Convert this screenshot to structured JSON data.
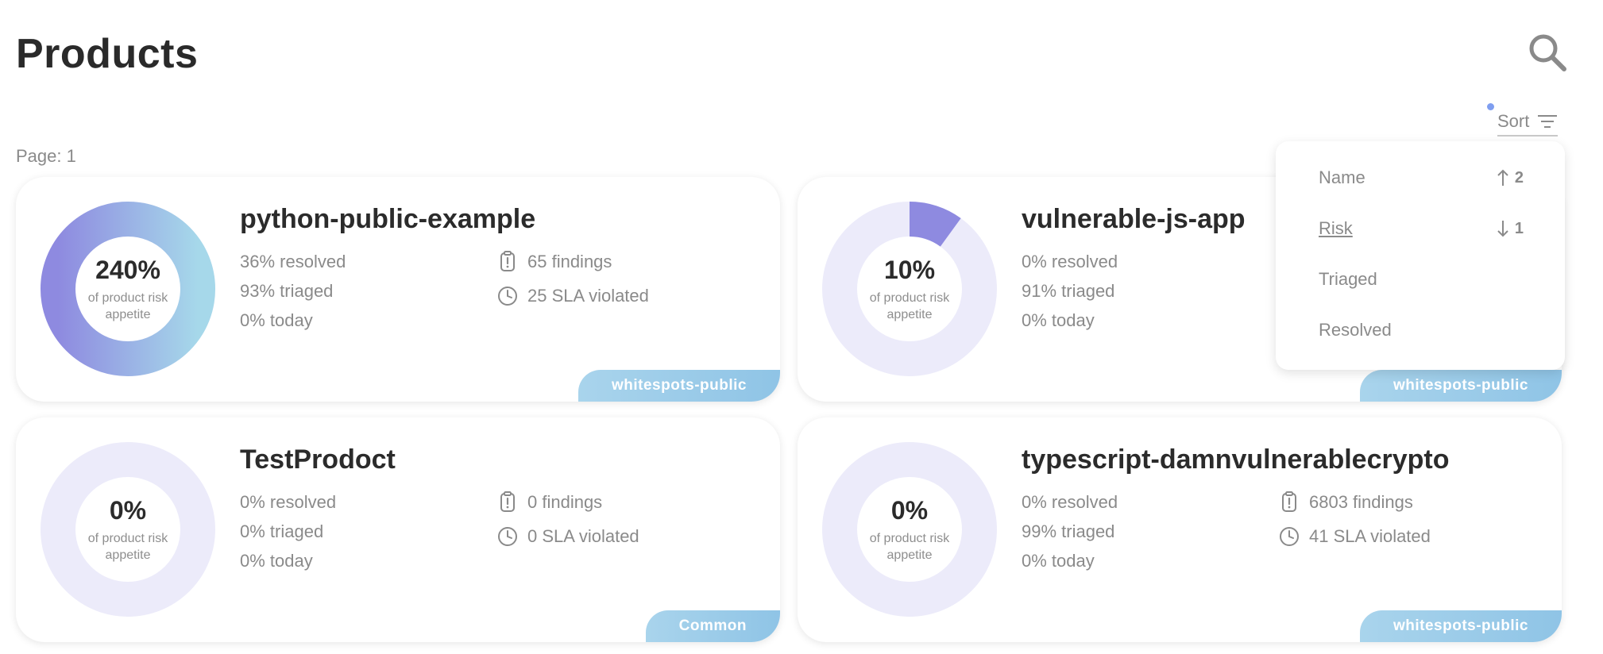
{
  "page": {
    "title": "Products",
    "page_label": "Page: 1",
    "search_icon": "search-icon"
  },
  "sort": {
    "label": "Sort",
    "icon": "filter-lines-icon",
    "options": [
      {
        "label": "Name",
        "direction": "up",
        "order": "2",
        "active": false
      },
      {
        "label": "Risk",
        "direction": "down",
        "order": "1",
        "active": true
      },
      {
        "label": "Triaged",
        "direction": "",
        "order": "",
        "active": false
      },
      {
        "label": "Resolved",
        "direction": "",
        "order": "",
        "active": false
      }
    ]
  },
  "products": [
    {
      "name": "python-public-example",
      "risk_percent": "240%",
      "risk_fraction": 1.0,
      "risk_caption": "of product risk appetite",
      "resolved": "36% resolved",
      "triaged": "93% triaged",
      "today": "0% today",
      "findings": "65 findings",
      "sla": "25 SLA violated",
      "tag": "whitespots-public"
    },
    {
      "name": "vulnerable-js-app",
      "risk_percent": "10%",
      "risk_fraction": 0.1,
      "risk_caption": "of product risk appetite",
      "resolved": "0% resolved",
      "triaged": "91% triaged",
      "today": "0% today",
      "findings": "",
      "sla": "",
      "tag": "whitespots-public"
    },
    {
      "name": "TestProdoct",
      "risk_percent": "0%",
      "risk_fraction": 0,
      "risk_caption": "of product risk appetite",
      "resolved": "0% resolved",
      "triaged": "0% triaged",
      "today": "0% today",
      "findings": "0 findings",
      "sla": "0 SLA violated",
      "tag": "Common"
    },
    {
      "name": "typescript-damnvulnerablecrypto",
      "risk_percent": "0%",
      "risk_fraction": 0,
      "risk_caption": "of product risk appetite",
      "resolved": "0% resolved",
      "triaged": "99% triaged",
      "today": "0% today",
      "findings": "6803 findings",
      "sla": "41 SLA violated",
      "tag": "whitespots-public"
    }
  ],
  "colors": {
    "ring_track": "#ecebfa",
    "ring_fill_top": "#8e8ae0",
    "ring_fill_bottom": "#a6d8ea",
    "tag_bg": "#9ccbe8",
    "muted_text": "#8a8a8a"
  }
}
